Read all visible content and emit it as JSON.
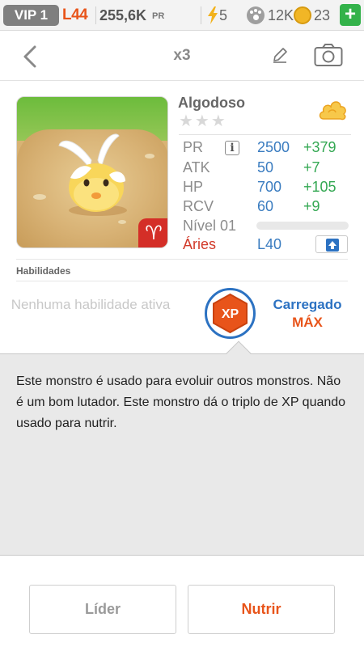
{
  "status_bar": {
    "vip": "VIP 1",
    "level": "L44",
    "power_value": "255,6K",
    "power_label": "PR",
    "energy": "5",
    "paws": "12K",
    "coins": "23",
    "add_label": "+"
  },
  "nav": {
    "title": "x3"
  },
  "monster": {
    "name": "Algodoso",
    "stars": "★★★",
    "sign_symbol": "♈",
    "stats": [
      {
        "label": "PR",
        "value": "2500",
        "bonus": "+379"
      },
      {
        "label": "ATK",
        "value": "50",
        "bonus": "+7"
      },
      {
        "label": "HP",
        "value": "700",
        "bonus": "+105"
      },
      {
        "label": "RCV",
        "value": "60",
        "bonus": "+9"
      }
    ],
    "info_label": "i",
    "level_label": "Nível 01",
    "xp_progress": 0,
    "zodiac": "Áries",
    "level_cap": "L40"
  },
  "abilities": {
    "title": "Habilidades",
    "none_text": "Nenhuma habilidade ativa",
    "xp_badge": "XP",
    "charged": "Carregado",
    "max": "MÁX"
  },
  "description": "Este monstro é usado para evoluir outros monstros. Não é um bom lutador. Este monstro dá o triplo de XP quando usado para nutrir.",
  "buttons": {
    "leader": "Líder",
    "feed": "Nutrir"
  },
  "colors": {
    "accent_orange": "#e8541a",
    "stat_blue": "#3a7cc0",
    "bonus_green": "#34a853",
    "zodiac_red": "#d23a2a"
  }
}
